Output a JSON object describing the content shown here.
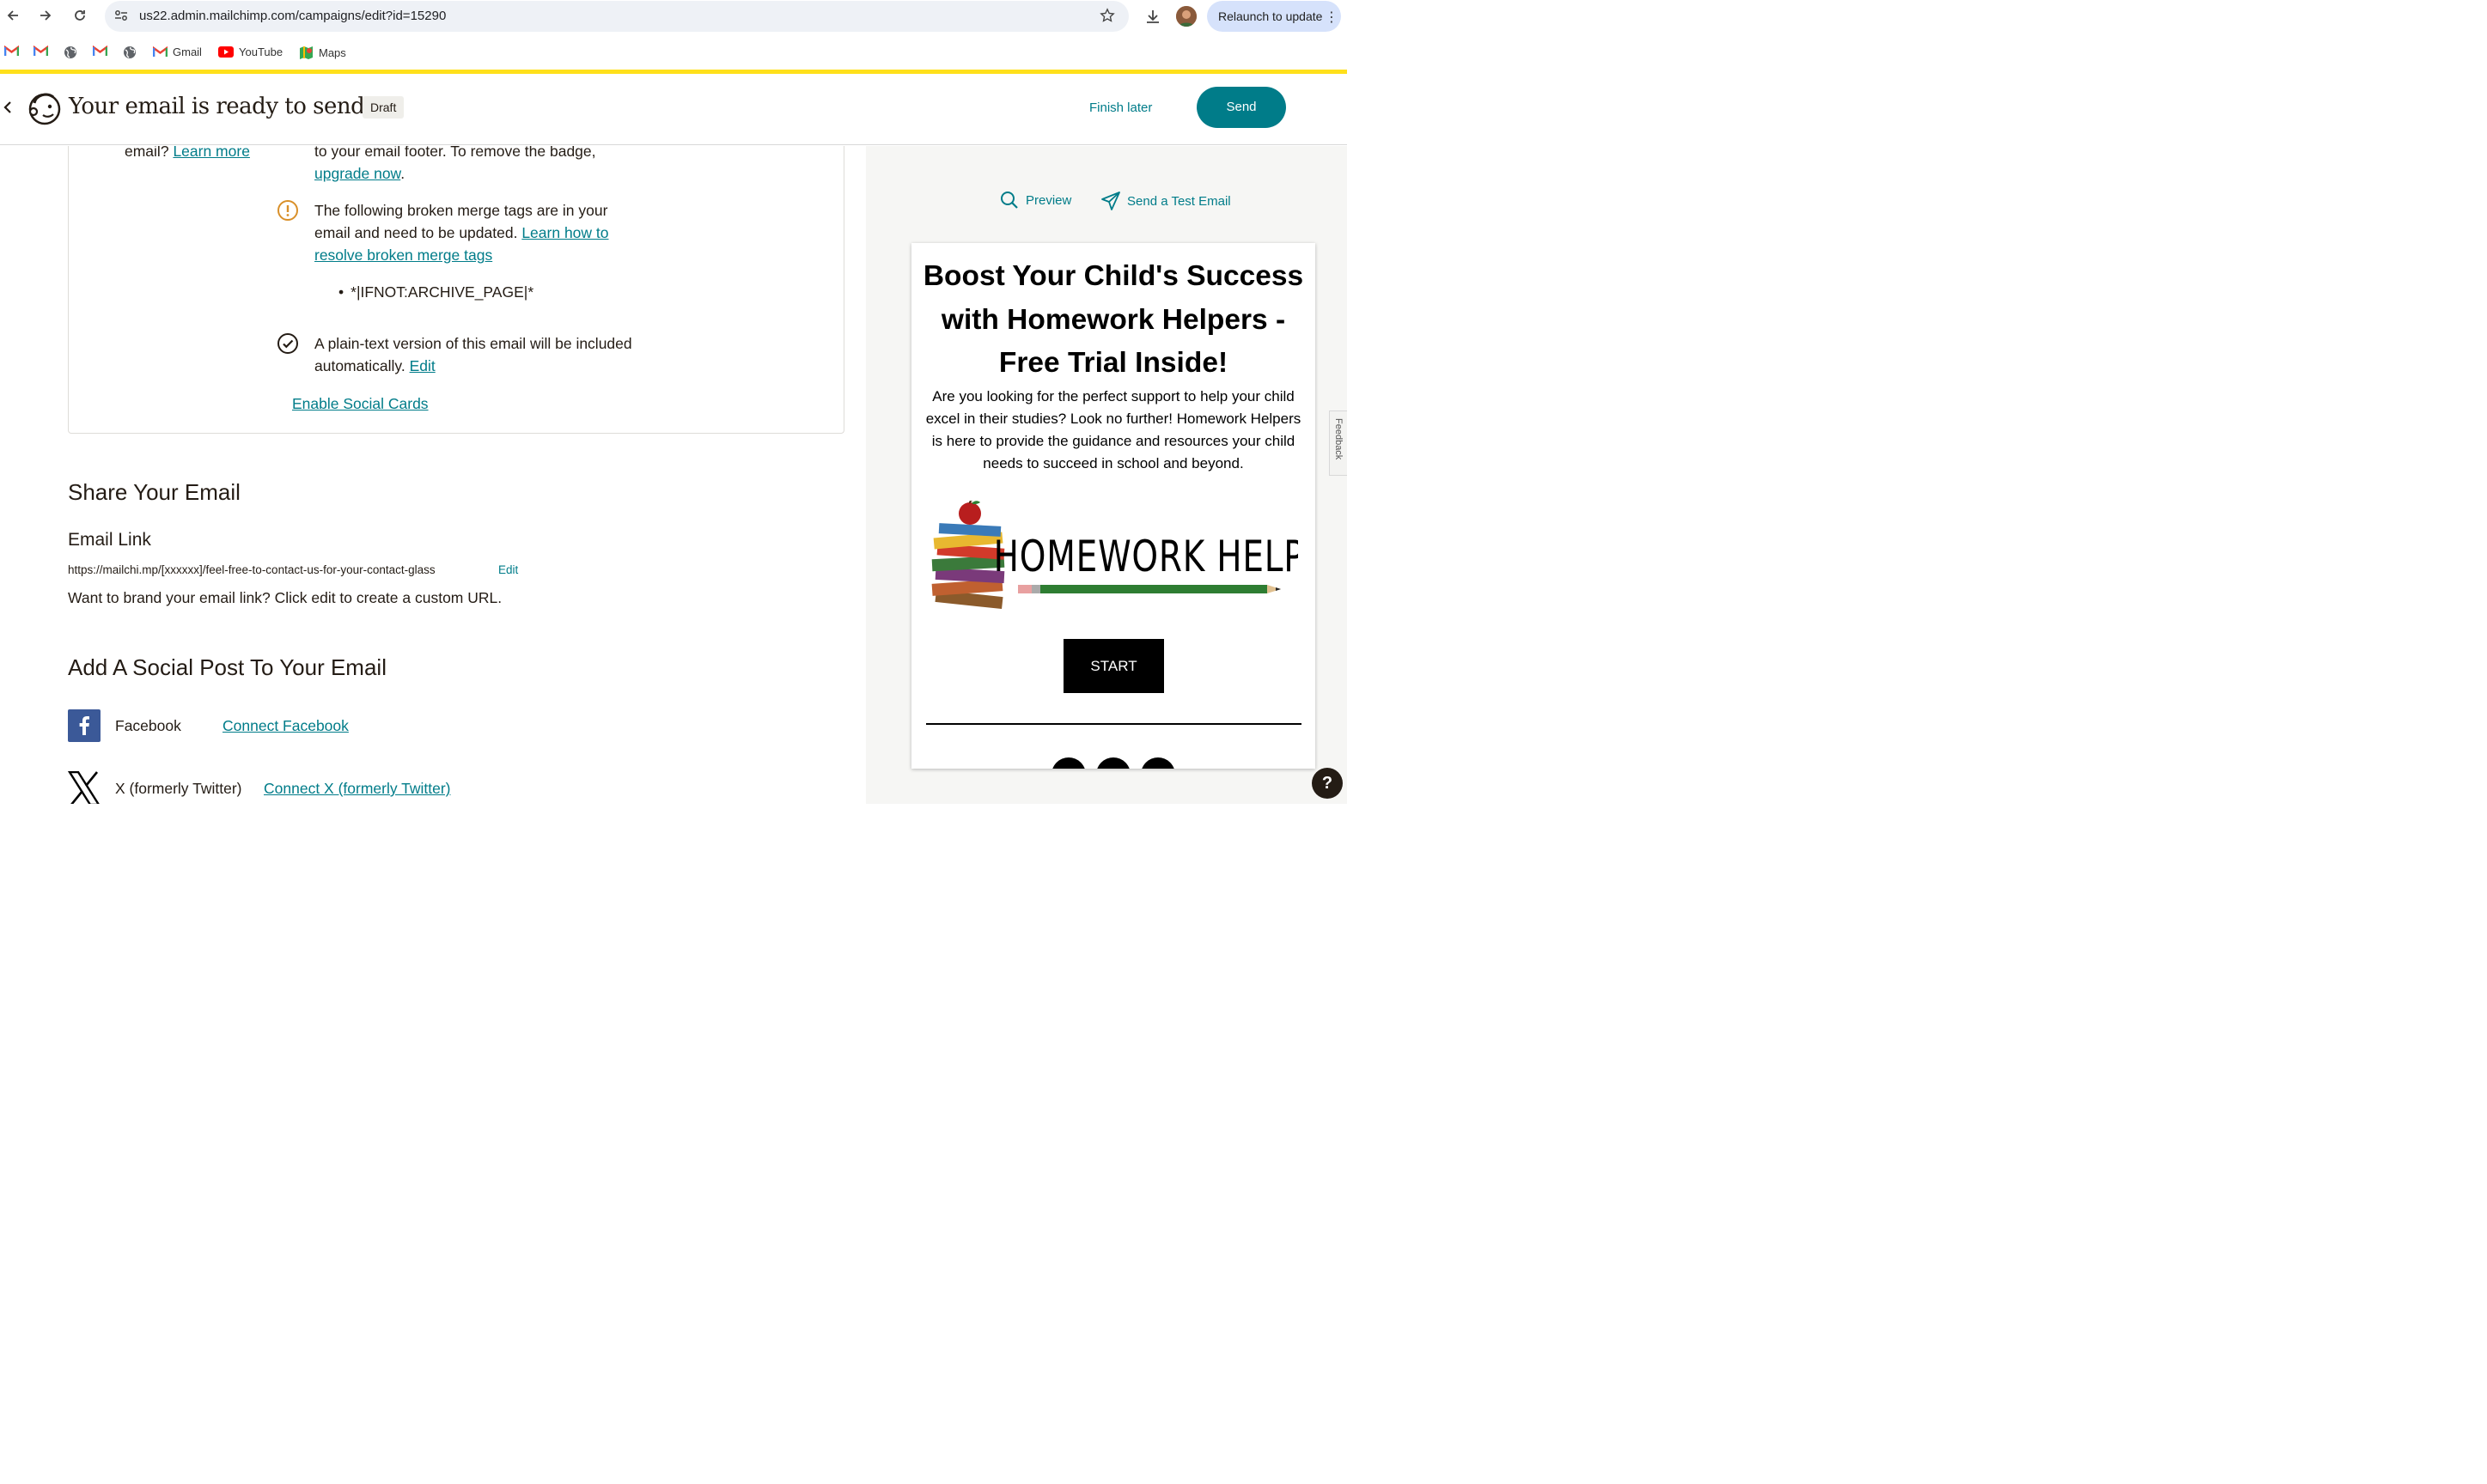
{
  "browser": {
    "url": "us22.admin.mailchimp.com/campaigns/edit?id=15290",
    "relaunch_label": "Relaunch to update",
    "bookmarks": [
      {
        "label": "",
        "icon": "gmail-icon"
      },
      {
        "label": "",
        "icon": "gmail-icon"
      },
      {
        "label": "",
        "icon": "globe-icon"
      },
      {
        "label": "",
        "icon": "gmail-icon"
      },
      {
        "label": "",
        "icon": "globe-icon"
      },
      {
        "label": "Gmail",
        "icon": "gmail-icon"
      },
      {
        "label": "YouTube",
        "icon": "youtube-icon"
      },
      {
        "label": "Maps",
        "icon": "maps-icon"
      }
    ]
  },
  "header": {
    "title": "Your email is ready to send!",
    "badge": "Draft",
    "finish_later": "Finish later",
    "send": "Send"
  },
  "checklist": {
    "learn_more_prefix": "email?",
    "learn_more": "Learn more",
    "badge_text": "to your email footer. To remove the badge,",
    "upgrade_now": "upgrade now",
    "period": ".",
    "merge_warning_text": "The following broken merge tags are in your email and need to be updated.",
    "merge_warning_link": "Learn how to resolve broken merge tags",
    "broken_tags": [
      "*|IFNOT:ARCHIVE_PAGE|*"
    ],
    "plaintext_text": "A plain-text version of this email will be included automatically.",
    "plaintext_edit": "Edit",
    "enable_social_cards": "Enable Social Cards"
  },
  "share": {
    "heading": "Share Your Email",
    "email_link_label": "Email Link",
    "email_link_url": "https://mailchi.mp/[xxxxxx]/feel-free-to-contact-us-for-your-contact-glass",
    "edit": "Edit",
    "brand_hint": "Want to brand your email link? Click edit to create a custom URL."
  },
  "social": {
    "heading": "Add A Social Post To Your Email",
    "facebook_label": "Facebook",
    "facebook_connect": "Connect Facebook",
    "x_label": "X (formerly Twitter)",
    "x_connect": "Connect X (formerly Twitter)"
  },
  "preview_pane": {
    "preview_label": "Preview",
    "test_email_label": "Send a Test Email",
    "headline": "Boost Your Child's Success with Homework Helpers - Free Trial Inside!",
    "body": "Are you looking for the perfect support to help your child excel in their studies? Look no further! Homework Helpers is here to provide the guidance and resources your child needs to succeed in school and beyond.",
    "logo_text": "HOMEWORK HELPERS",
    "cta": "START",
    "feedback": "Feedback"
  },
  "colors": {
    "accent": "#007c89",
    "brand_yellow": "#ffe01b",
    "text": "#241c15",
    "warning": "#d9902a"
  }
}
